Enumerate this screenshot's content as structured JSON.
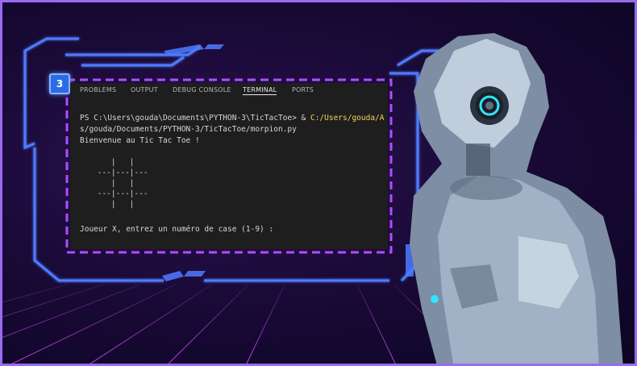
{
  "badge": {
    "number": "3"
  },
  "tabs": [
    {
      "label": "PROBLEMS",
      "active": false
    },
    {
      "label": "OUTPUT",
      "active": false
    },
    {
      "label": "DEBUG CONSOLE",
      "active": false
    },
    {
      "label": "TERMINAL",
      "active": true
    },
    {
      "label": "PORTS",
      "active": false
    }
  ],
  "terminal": {
    "prompt": "PS C:\\Users\\gouda\\Documents\\PYTHON-3\\TicTacToe> & ",
    "command_path": "C:/Users/gouda/A",
    "path_continued": "s/gouda/Documents/PYTHON-3/TicTacToe/morpion.py",
    "welcome": "Bienvenue au Tic Tac Toe !",
    "board": [
      "    |   |",
      " ---|---|---",
      "    |   |",
      " ---|---|---",
      "    |   |"
    ],
    "input_prompt": "Joueur X, entrez un numéro de case (1-9) :"
  },
  "colors": {
    "frame_border": "#9a6bf0",
    "neon_blue": "#4d7bff",
    "neon_purple": "#b04dff",
    "terminal_bg": "#1e1e1e",
    "highlight_yellow": "#f1d35b"
  }
}
